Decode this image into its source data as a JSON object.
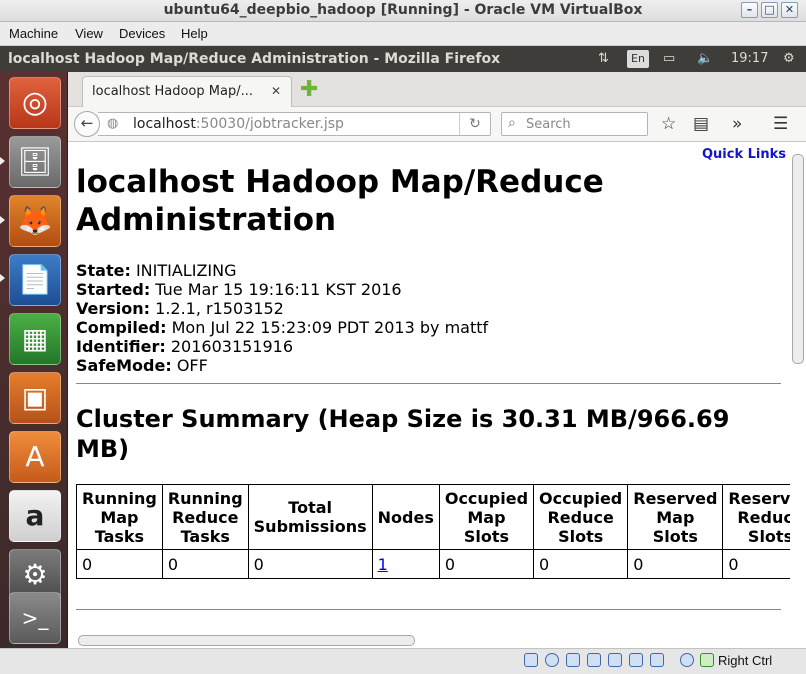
{
  "vbox": {
    "title": "ubuntu64_deepbio_hadoop [Running] - Oracle VM VirtualBox",
    "menu": [
      "Machine",
      "View",
      "Devices",
      "Help"
    ],
    "status_key": "Right Ctrl"
  },
  "panel": {
    "window_title": "localhost Hadoop Map/Reduce Administration - Mozilla Firefox",
    "keyboard_layout": "En",
    "time": "19:17"
  },
  "launcher": {
    "icons": [
      "ubuntu-dash-icon",
      "files-icon",
      "firefox-icon",
      "writer-icon",
      "calc-icon",
      "impress-icon",
      "software-center-icon",
      "amazon-icon",
      "system-settings-icon",
      "terminal-icon"
    ]
  },
  "browser": {
    "tab_title": "localhost Hadoop Map/...",
    "url_host": "localhost",
    "url_rest": ":50030/jobtracker.jsp",
    "search_placeholder": "Search"
  },
  "page": {
    "quick_links": "Quick Links",
    "title": "localhost Hadoop Map/Reduce Administration",
    "info": [
      {
        "label": "State:",
        "value": " INITIALIZING"
      },
      {
        "label": "Started:",
        "value": " Tue Mar 15 19:16:11 KST 2016"
      },
      {
        "label": "Version:",
        "value": " 1.2.1, r1503152"
      },
      {
        "label": "Compiled:",
        "value": " Mon Jul 22 15:23:09 PDT 2013 by mattf"
      },
      {
        "label": "Identifier:",
        "value": " 201603151916"
      },
      {
        "label": "SafeMode:",
        "value": " OFF"
      }
    ],
    "cluster_heading": "Cluster Summary (Heap Size is 30.31 MB/966.69 MB)",
    "table": {
      "headers": [
        "Running Map Tasks",
        "Running Reduce Tasks",
        "Total Submissions",
        "Nodes",
        "Occupied Map Slots",
        "Occupied Reduce Slots",
        "Reserved Map Slots",
        "Reserved Reduce Slots"
      ],
      "row": [
        "0",
        "0",
        "0",
        "1",
        "0",
        "0",
        "0",
        "0"
      ]
    }
  }
}
